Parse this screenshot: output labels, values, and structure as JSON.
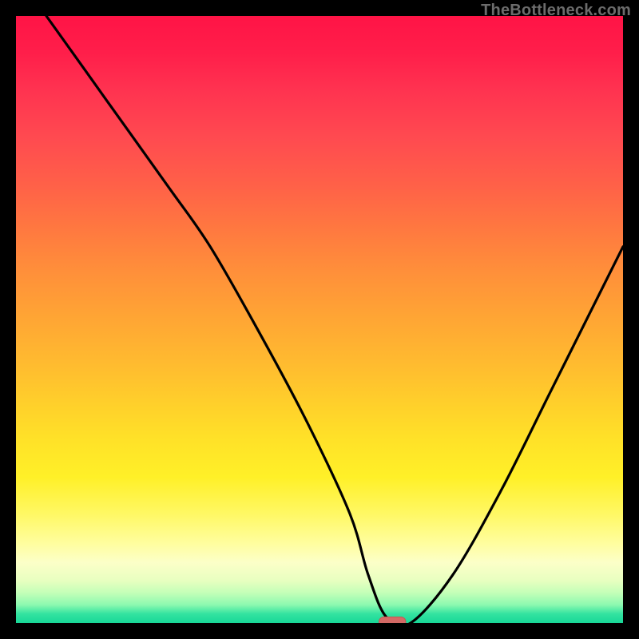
{
  "watermark": "TheBottleneck.com",
  "colors": {
    "background": "#000000",
    "curve": "#000000",
    "marker_fill": "#d46a66",
    "marker_stroke": "#c35752"
  },
  "chart_data": {
    "type": "line",
    "title": "",
    "xlabel": "",
    "ylabel": "",
    "xlim": [
      0,
      100
    ],
    "ylim": [
      0,
      100
    ],
    "grid": false,
    "legend": false,
    "bottleneck_x": 62,
    "series": [
      {
        "name": "curve",
        "x": [
          5,
          15,
          25,
          32,
          40,
          48,
          55,
          58,
          61,
          65,
          72,
          80,
          88,
          96,
          100
        ],
        "y": [
          100,
          86,
          72,
          62,
          48,
          33,
          18,
          8,
          1,
          0,
          8,
          22,
          38,
          54,
          62
        ]
      }
    ],
    "marker": {
      "x": 62,
      "y": 0,
      "rx": 2.2,
      "ry": 1.0
    }
  }
}
